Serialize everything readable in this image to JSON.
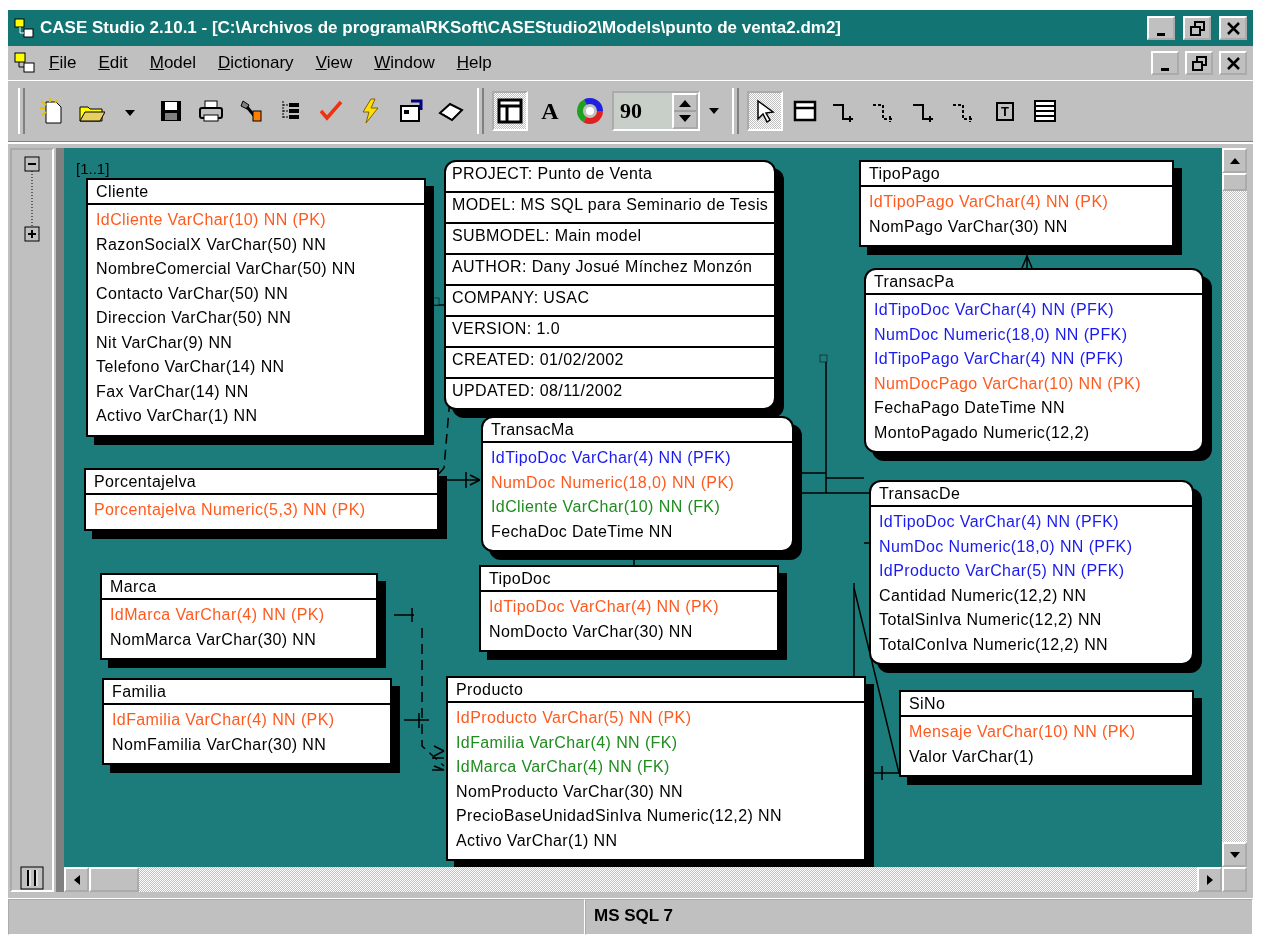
{
  "window": {
    "title": "CASE Studio 2.10.1 - [C:\\Archivos de programa\\RKSoft\\CASEStudio2\\Models\\punto de venta2.dm2]"
  },
  "menu": [
    "File",
    "Edit",
    "Model",
    "Dictionary",
    "View",
    "Window",
    "Help"
  ],
  "toolbar": {
    "view_buttons": [
      {
        "kind": "layout",
        "pressed": true
      },
      {
        "kind": "font",
        "label": "A",
        "pressed": false
      },
      {
        "kind": "color",
        "pressed": false
      }
    ],
    "zoom": "90",
    "tools": [
      {
        "kind": "pointer",
        "pressed": true
      },
      {
        "kind": "entity",
        "pressed": false
      },
      {
        "kind": "relation",
        "pressed": false
      },
      {
        "kind": "relation-dashed",
        "pressed": false
      },
      {
        "kind": "relation",
        "pressed": false
      },
      {
        "kind": "relation-dashed",
        "pressed": false
      },
      {
        "kind": "text",
        "label": "T",
        "pressed": false
      },
      {
        "kind": "table",
        "pressed": false
      }
    ]
  },
  "diagram": {
    "label": "[1..1]",
    "info": {
      "rows": [
        "PROJECT: Punto de Venta",
        "MODEL: MS SQL para Seminario de Tesis",
        "SUBMODEL: Main model",
        "AUTHOR: Dany Josué Mínchez Monzón",
        "COMPANY: USAC",
        "VERSION: 1.0",
        "CREATED: 01/02/2002",
        "UPDATED: 08/11/2002"
      ]
    },
    "entities": [
      {
        "name": "Cliente",
        "rounded": false,
        "columns": [
          {
            "text": "IdCliente VarChar(10) NN (PK)",
            "kind": "pk"
          },
          {
            "text": "RazonSocialX VarChar(50) NN",
            "kind": "attr"
          },
          {
            "text": "NombreComercial VarChar(50) NN",
            "kind": "attr"
          },
          {
            "text": "Contacto VarChar(50) NN",
            "kind": "attr"
          },
          {
            "text": "Direccion VarChar(50) NN",
            "kind": "attr"
          },
          {
            "text": "Nit VarChar(9) NN",
            "kind": "attr"
          },
          {
            "text": "Telefono VarChar(14) NN",
            "kind": "attr"
          },
          {
            "text": "Fax VarChar(14) NN",
            "kind": "attr"
          },
          {
            "text": "Activo VarChar(1) NN",
            "kind": "attr"
          }
        ]
      },
      {
        "name": "Porcentajelva",
        "rounded": false,
        "columns": [
          {
            "text": "Porcentajelva Numeric(5,3) NN (PK)",
            "kind": "pk"
          }
        ]
      },
      {
        "name": "Marca",
        "rounded": false,
        "columns": [
          {
            "text": "IdMarca VarChar(4) NN (PK)",
            "kind": "pk"
          },
          {
            "text": "NomMarca VarChar(30) NN",
            "kind": "attr"
          }
        ]
      },
      {
        "name": "Familia",
        "rounded": false,
        "columns": [
          {
            "text": "IdFamilia VarChar(4) NN (PK)",
            "kind": "pk"
          },
          {
            "text": "NomFamilia VarChar(30) NN",
            "kind": "attr"
          }
        ]
      },
      {
        "name": "TransacMa",
        "rounded": true,
        "columns": [
          {
            "text": "IdTipoDoc VarChar(4) NN (PFK)",
            "kind": "pfk"
          },
          {
            "text": "NumDoc Numeric(18,0) NN (PK)",
            "kind": "pk"
          },
          {
            "text": "IdCliente VarChar(10) NN (FK)",
            "kind": "fk"
          },
          {
            "text": "FechaDoc DateTime NN",
            "kind": "attr"
          }
        ]
      },
      {
        "name": "TipoDoc",
        "rounded": false,
        "columns": [
          {
            "text": "IdTipoDoc VarChar(4) NN (PK)",
            "kind": "pk"
          },
          {
            "text": "NomDocto VarChar(30) NN",
            "kind": "attr"
          }
        ]
      },
      {
        "name": "Producto",
        "rounded": false,
        "columns": [
          {
            "text": "IdProducto VarChar(5) NN (PK)",
            "kind": "pk"
          },
          {
            "text": "IdFamilia VarChar(4) NN (FK)",
            "kind": "fk"
          },
          {
            "text": "IdMarca VarChar(4) NN (FK)",
            "kind": "fk"
          },
          {
            "text": "NomProducto VarChar(30) NN",
            "kind": "attr"
          },
          {
            "text": "PrecioBaseUnidadSinIva Numeric(12,2) NN",
            "kind": "attr"
          },
          {
            "text": "Activo VarChar(1) NN",
            "kind": "attr"
          }
        ]
      },
      {
        "name": "TipoPago",
        "rounded": false,
        "columns": [
          {
            "text": "IdTipoPago VarChar(4) NN (PK)",
            "kind": "pk"
          },
          {
            "text": "NomPago VarChar(30) NN",
            "kind": "attr"
          }
        ]
      },
      {
        "name": "TransacPa",
        "rounded": true,
        "columns": [
          {
            "text": "IdTipoDoc VarChar(4) NN (PFK)",
            "kind": "pfk"
          },
          {
            "text": "NumDoc Numeric(18,0) NN (PFK)",
            "kind": "pfk"
          },
          {
            "text": "IdTipoPago VarChar(4) NN (PFK)",
            "kind": "pfk"
          },
          {
            "text": "NumDocPago VarChar(10) NN (PK)",
            "kind": "pk"
          },
          {
            "text": "FechaPago DateTime NN",
            "kind": "attr"
          },
          {
            "text": "MontoPagado Numeric(12,2)",
            "kind": "attr"
          }
        ]
      },
      {
        "name": "TransacDe",
        "rounded": true,
        "columns": [
          {
            "text": "IdTipoDoc VarChar(4) NN (PFK)",
            "kind": "pfk"
          },
          {
            "text": "NumDoc Numeric(18,0) NN (PFK)",
            "kind": "pfk"
          },
          {
            "text": "IdProducto VarChar(5) NN (PFK)",
            "kind": "pfk"
          },
          {
            "text": "Cantidad Numeric(12,2) NN",
            "kind": "attr"
          },
          {
            "text": "TotalSinIva Numeric(12,2) NN",
            "kind": "attr"
          },
          {
            "text": "TotalConIva Numeric(12,2) NN",
            "kind": "attr"
          }
        ]
      },
      {
        "name": "SiNo",
        "rounded": false,
        "columns": [
          {
            "text": "Mensaje VarChar(10) NN (PK)",
            "kind": "pk"
          },
          {
            "text": "Valor VarChar(1)",
            "kind": "attr"
          }
        ]
      }
    ]
  },
  "status_bar": {
    "database": "MS SQL 7"
  }
}
